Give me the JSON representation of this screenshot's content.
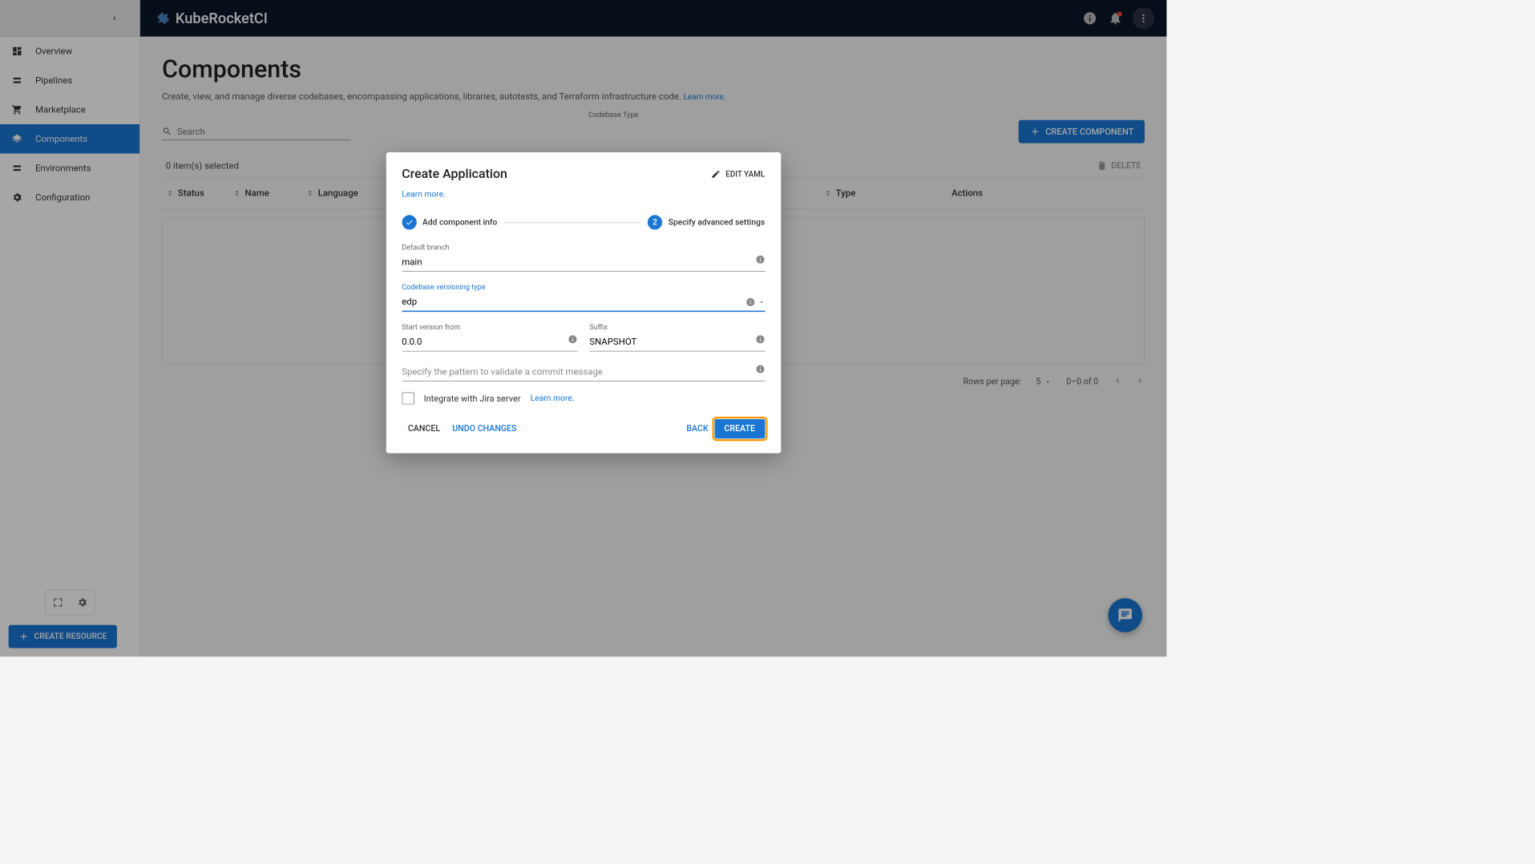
{
  "brand": "KubeRocketCI",
  "sidebar": {
    "items": [
      {
        "label": "Overview"
      },
      {
        "label": "Pipelines"
      },
      {
        "label": "Marketplace"
      },
      {
        "label": "Components"
      },
      {
        "label": "Environments"
      },
      {
        "label": "Configuration"
      }
    ],
    "create_resource": "CREATE RESOURCE"
  },
  "page": {
    "title": "Components",
    "subtitle": "Create, view, and manage diverse codebases, encompassing applications, libraries, autotests, and Terraform infrastructure code.",
    "learn_more": "Learn more."
  },
  "filters": {
    "search_placeholder": "Search",
    "codebase_type_label": "Codebase Type",
    "create_component": "CREATE COMPONENT"
  },
  "selection": "0 item(s) selected",
  "delete_label": "DELETE",
  "table": {
    "status": "Status",
    "name": "Name",
    "language": "Language",
    "type": "Type",
    "actions": "Actions"
  },
  "pagination": {
    "rows_label": "Rows per page:",
    "page_size": "5",
    "range": "0–0 of 0"
  },
  "dialog": {
    "title": "Create Application",
    "edit_yaml": "EDIT YAML",
    "learn_more": "Learn more.",
    "step1": "Add component info",
    "step2_num": "2",
    "step2": "Specify advanced settings",
    "fields": {
      "default_branch_label": "Default branch",
      "default_branch_value": "main",
      "versioning_label": "Codebase versioning type",
      "versioning_value": "edp",
      "start_version_label": "Start version from",
      "start_version_value": "0.0.0",
      "suffix_label": "Suffix",
      "suffix_value": "SNAPSHOT",
      "commit_pattern_placeholder": "Specify the pattern to validate a commit message"
    },
    "jira_label": "Integrate with Jira server",
    "jira_learn_more": "Learn more.",
    "actions": {
      "cancel": "CANCEL",
      "undo": "UNDO CHANGES",
      "back": "BACK",
      "create": "CREATE"
    }
  }
}
